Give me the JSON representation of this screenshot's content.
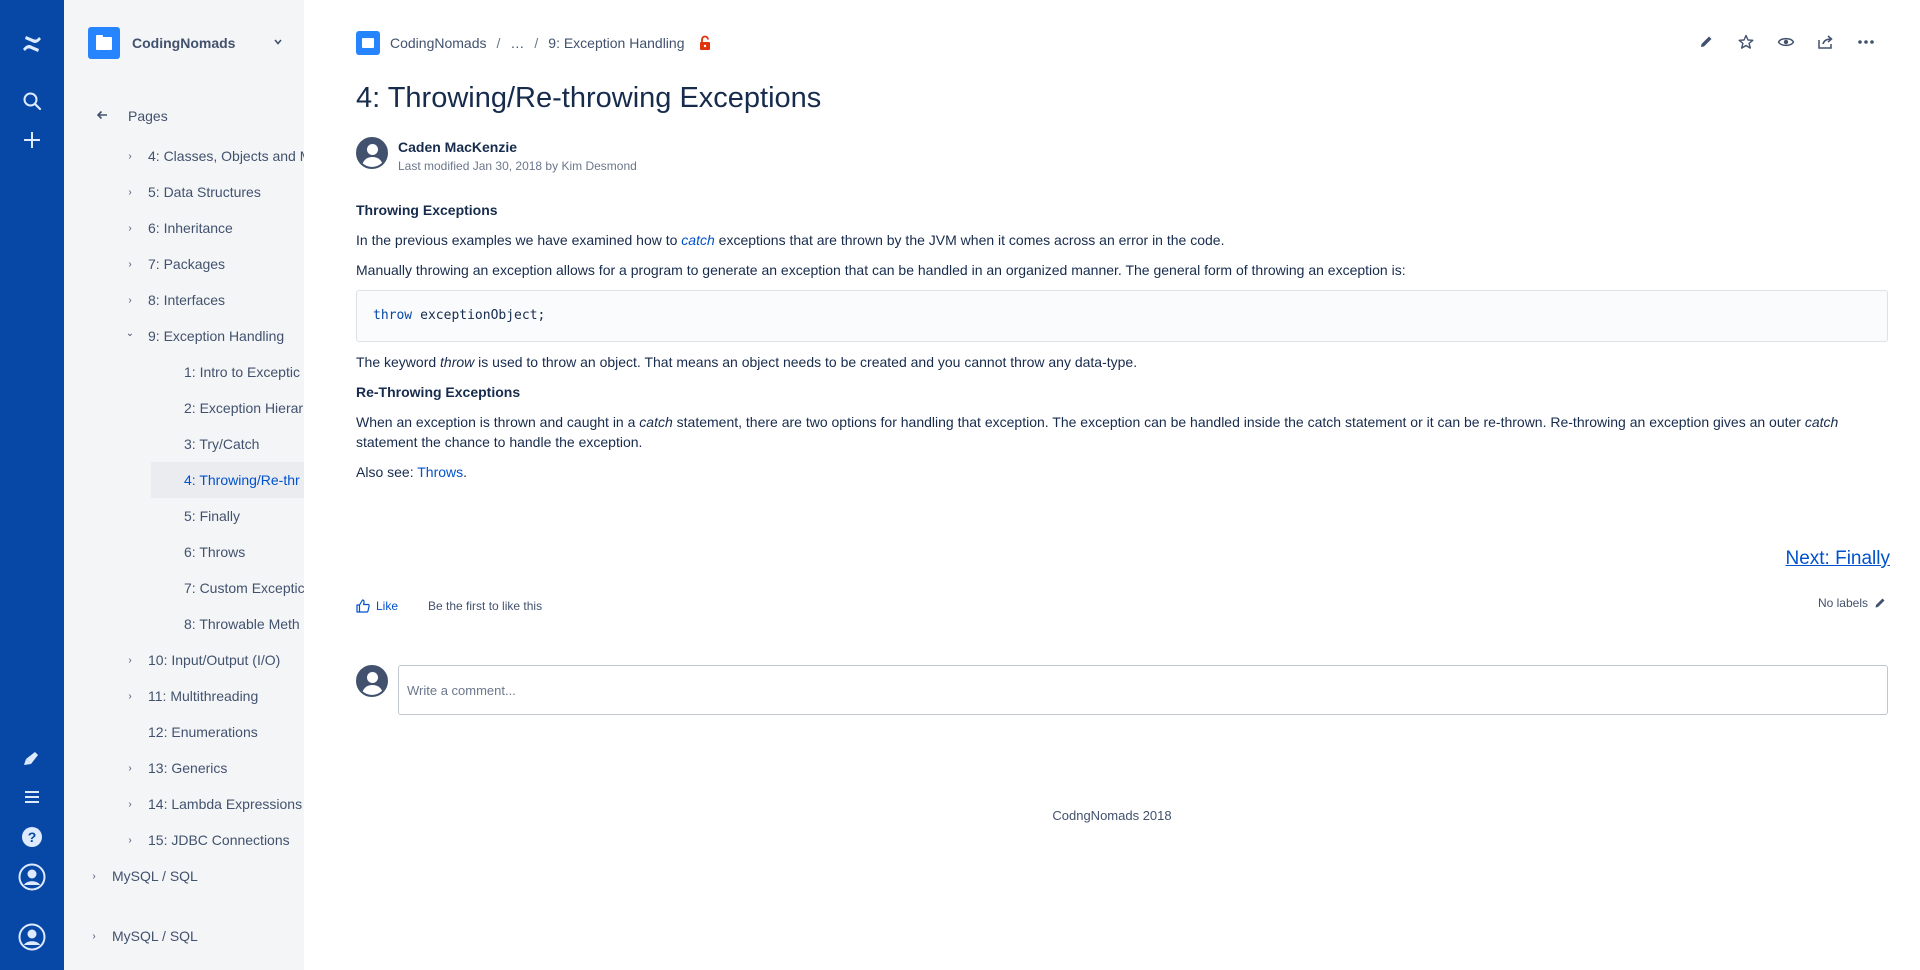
{
  "global_nav": {
    "icons": [
      "confluence-logo-icon",
      "search-icon",
      "create-icon",
      "feedback-icon",
      "menu-icon",
      "help-icon",
      "user-profile-icon",
      "user-profile-icon"
    ]
  },
  "sidebar": {
    "space_name": "CodingNomads",
    "pages_label": "Pages",
    "tree": [
      {
        "label": "4: Classes, Objects and M",
        "level": 1,
        "expander": "›"
      },
      {
        "label": "5: Data Structures",
        "level": 1,
        "expander": "›"
      },
      {
        "label": "6: Inheritance",
        "level": 1,
        "expander": "›"
      },
      {
        "label": "7: Packages",
        "level": 1,
        "expander": "›"
      },
      {
        "label": "8: Interfaces",
        "level": 1,
        "expander": "›"
      },
      {
        "label": "9: Exception Handling",
        "level": 1,
        "expander": "⌄"
      },
      {
        "label": "1: Intro to Exceptic",
        "level": 2
      },
      {
        "label": "2: Exception Hierar",
        "level": 2
      },
      {
        "label": "3: Try/Catch",
        "level": 2
      },
      {
        "label": "4: Throwing/Re-thr",
        "level": 2,
        "selected": true
      },
      {
        "label": "5: Finally",
        "level": 2
      },
      {
        "label": "6: Throws",
        "level": 2
      },
      {
        "label": "7: Custom Exceptic",
        "level": 2
      },
      {
        "label": "8: Throwable Meth",
        "level": 2
      },
      {
        "label": "10: Input/Output (I/O)",
        "level": 1,
        "expander": "›"
      },
      {
        "label": "11: Multithreading",
        "level": 1,
        "expander": "›"
      },
      {
        "label": "12: Enumerations",
        "level": 1
      },
      {
        "label": "13: Generics",
        "level": 1,
        "expander": "›"
      },
      {
        "label": "14: Lambda Expressions",
        "level": 1,
        "expander": "›"
      },
      {
        "label": "15: JDBC Connections",
        "level": 1,
        "expander": "›"
      },
      {
        "label": "MySQL / SQL",
        "level": 0,
        "expander": "›"
      }
    ],
    "bottom_item": "MySQL / SQL"
  },
  "breadcrumb": {
    "space": "CodingNomads",
    "ellipsis": "…",
    "parent": "9: Exception Handling",
    "sep": "/"
  },
  "page": {
    "title": "4: Throwing/Re-throwing Exceptions",
    "author": "Caden MacKenzie",
    "modified": "Last modified Jan 30, 2018 by Kim Desmond",
    "h_throwing": "Throwing Exceptions",
    "p1_a": "In the previous examples we have examined how to ",
    "p1_em": "catch",
    "p1_b": " exceptions that are thrown by the JVM when it comes across an error in the code.",
    "p2": "Manually throwing an exception allows for a program to generate an exception that can be handled in an organized manner. The general form of throwing an exception is:",
    "code_kw": "throw",
    "code_rest": "exceptionObject;",
    "p3_a": "The keyword ",
    "p3_em": "throw",
    "p3_b": " is used to throw an object. That means an object needs to be created and you cannot throw any data-type.",
    "h_rethrowing": "Re-Throwing Exceptions",
    "p4_a": "When an exception is thrown and caught in a ",
    "p4_em1": "catch",
    "p4_b": " statement, there are two options for handling that exception. The exception can be handled inside the catch statement or it can be re-thrown. Re-throwing an exception gives an outer ",
    "p4_em2": "catch",
    "p4_c": " statement the chance to handle the exception.",
    "p5_a": "Also see: ",
    "p5_link": "Throws",
    "p5_b": ".",
    "next_link": "Next: Finally",
    "like_label": "Like",
    "like_hint": "Be the first to like this",
    "labels_text": "No labels",
    "comment_placeholder": "Write a comment...",
    "footer": "CodngNomads 2018"
  },
  "colors": {
    "global_nav_bg": "#0747a6",
    "sidebar_bg": "#f4f5f7",
    "link": "#0052cc",
    "text": "#172b4d",
    "lock": "#de350b"
  }
}
